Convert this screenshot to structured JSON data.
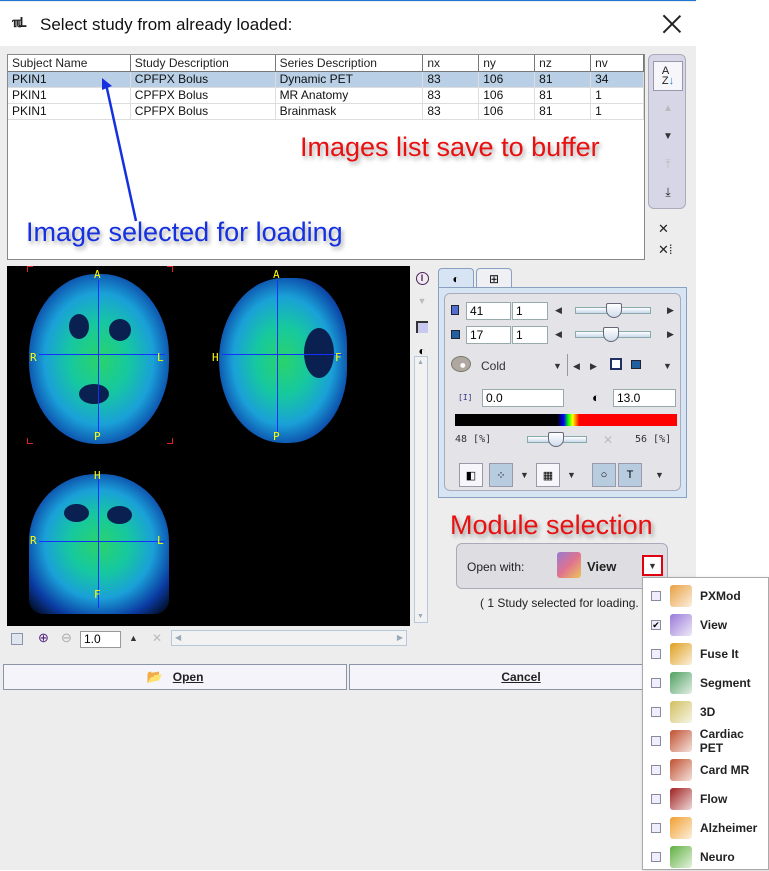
{
  "dialog": {
    "title": "Select study from already loaded:",
    "title_icon": "pmod-logo-icon"
  },
  "table": {
    "columns": [
      "Subject Name",
      "Study Description",
      "Series Description",
      "nx",
      "ny",
      "nz",
      "nv"
    ],
    "rows": [
      {
        "selected": true,
        "cells": [
          "PKIN1",
          "CPFPX Bolus",
          "Dynamic PET",
          "83",
          "106",
          "81",
          "34"
        ]
      },
      {
        "selected": false,
        "cells": [
          "PKIN1",
          "CPFPX Bolus",
          "MR Anatomy",
          "83",
          "106",
          "81",
          "1"
        ]
      },
      {
        "selected": false,
        "cells": [
          "PKIN1",
          "CPFPX Bolus",
          "Brainmask",
          "83",
          "106",
          "81",
          "1"
        ]
      }
    ]
  },
  "list_tools": {
    "sort": "sort-az-icon",
    "move_up": "triangle-up-icon",
    "move_down": "triangle-down-icon",
    "move_top": "move-top-icon",
    "save_buffer": "download-icon",
    "remove": "close-icon",
    "remove_all": "remove-all-icon"
  },
  "annotations": {
    "list_buffer": "Images list save to buffer",
    "selected": "Image selected for loading",
    "module": "Module selection"
  },
  "viewer": {
    "axial_labels": {
      "top": "A",
      "bottom": "P",
      "left": "R",
      "right": "L"
    },
    "sagittal_labels": {
      "top": "A",
      "bottom": "P",
      "left": "H",
      "right": "F"
    },
    "coronal_labels": {
      "top": "H",
      "bottom": "F",
      "left": "R",
      "right": "L"
    }
  },
  "controls": {
    "slice": {
      "value": "41",
      "step": "1",
      "fraction": 0.52
    },
    "frame": {
      "value": "17",
      "step": "1",
      "fraction": 0.47
    },
    "colortable": "Cold",
    "min": "0.0",
    "max": "13.0",
    "lower_pct": "48 [%]",
    "upper_pct": "56 [%]",
    "threshold_fraction": 0.48
  },
  "open_with": {
    "label": "Open with:",
    "value": "View"
  },
  "status": "( 1 Study selected for loading.",
  "zoom": {
    "value": "1.0"
  },
  "buttons": {
    "open": "Open",
    "cancel": "Cancel"
  },
  "modules": [
    {
      "label": "PXMod",
      "checked": false,
      "color": "#e8a040"
    },
    {
      "label": "View",
      "checked": true,
      "color": "#9a7ad8"
    },
    {
      "label": "Fuse It",
      "checked": false,
      "color": "#e0a020"
    },
    {
      "label": "Segment",
      "checked": false,
      "color": "#50a060"
    },
    {
      "label": "3D",
      "checked": false,
      "color": "#d0c060"
    },
    {
      "label": "Cardiac PET",
      "checked": false,
      "color": "#c05030"
    },
    {
      "label": "Card MR",
      "checked": false,
      "color": "#c05030"
    },
    {
      "label": "Flow",
      "checked": false,
      "color": "#a02020"
    },
    {
      "label": "Alzheimer",
      "checked": false,
      "color": "#f0a030"
    },
    {
      "label": "Neuro",
      "checked": false,
      "color": "#60b040"
    }
  ]
}
